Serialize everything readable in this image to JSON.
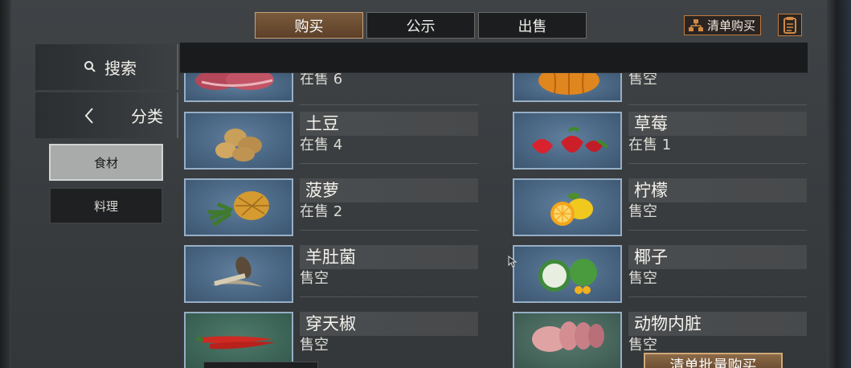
{
  "tabs": [
    {
      "label": "购买",
      "active": true
    },
    {
      "label": "公示",
      "active": false
    },
    {
      "label": "出售",
      "active": false
    }
  ],
  "header": {
    "list_buy_label": "清单购买",
    "list_buy_icon": "org-chart-icon",
    "clipboard_icon": "clipboard-icon"
  },
  "sidebar": {
    "search_label": "搜索",
    "category_label": "分类",
    "sub_categories": [
      {
        "label": "食材",
        "selected": true
      },
      {
        "label": "料理",
        "selected": false
      }
    ]
  },
  "items": [
    {
      "name": "",
      "status": "在售 6",
      "icon": "meat-icon"
    },
    {
      "name": "",
      "status": "售空",
      "icon": "pumpkin-icon"
    },
    {
      "name": "土豆",
      "status": "在售 4",
      "icon": "potato-icon"
    },
    {
      "name": "草莓",
      "status": "在售 1",
      "icon": "strawberry-icon"
    },
    {
      "name": "菠萝",
      "status": "在售 2",
      "icon": "pineapple-icon"
    },
    {
      "name": "柠檬",
      "status": "售空",
      "icon": "lemon-icon"
    },
    {
      "name": "羊肚菌",
      "status": "售空",
      "icon": "morel-icon"
    },
    {
      "name": "椰子",
      "status": "售空",
      "icon": "coconut-icon"
    },
    {
      "name": "穿天椒",
      "status": "售空",
      "icon": "chili-pepper-icon"
    },
    {
      "name": "动物内脏",
      "status": "售空",
      "icon": "offal-icon"
    }
  ],
  "footer": {
    "batch_buy_label": "清单批量购买"
  },
  "colors": {
    "accent": "#c07a3c",
    "tab_active": "#6b4c32",
    "thumb_bg": "#4a6784"
  }
}
